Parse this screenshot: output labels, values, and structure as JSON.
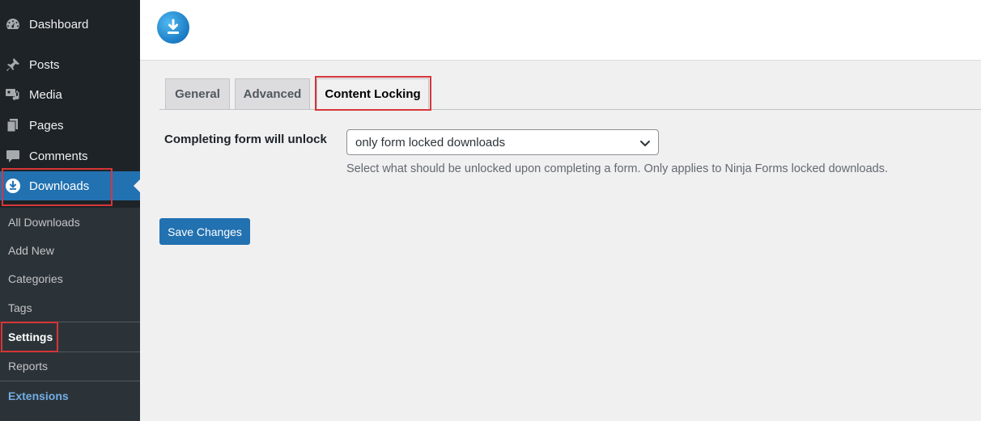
{
  "sidebar": {
    "items": [
      {
        "label": "Dashboard",
        "icon": "dashboard-icon"
      },
      {
        "label": "Posts",
        "icon": "pin-icon"
      },
      {
        "label": "Media",
        "icon": "media-icon"
      },
      {
        "label": "Pages",
        "icon": "pages-icon"
      },
      {
        "label": "Comments",
        "icon": "comment-icon"
      },
      {
        "label": "Downloads",
        "icon": "download-icon"
      }
    ],
    "submenu": [
      "All Downloads",
      "Add New",
      "Categories",
      "Tags",
      "Settings",
      "Reports",
      "Extensions"
    ]
  },
  "header": {
    "logo_icon": "download-logo-icon"
  },
  "tabs": [
    "General",
    "Advanced",
    "Content Locking"
  ],
  "active_tab": "Content Locking",
  "form": {
    "label": "Completing form will unlock",
    "select_value": "only form locked downloads",
    "description": "Select what should be unlocked upon completing a form. Only applies to Ninja Forms locked downloads."
  },
  "save_label": "Save Changes",
  "colors": {
    "accent": "#2271b1",
    "highlight": "#d63638",
    "sidebar_bg": "#1d2327"
  }
}
